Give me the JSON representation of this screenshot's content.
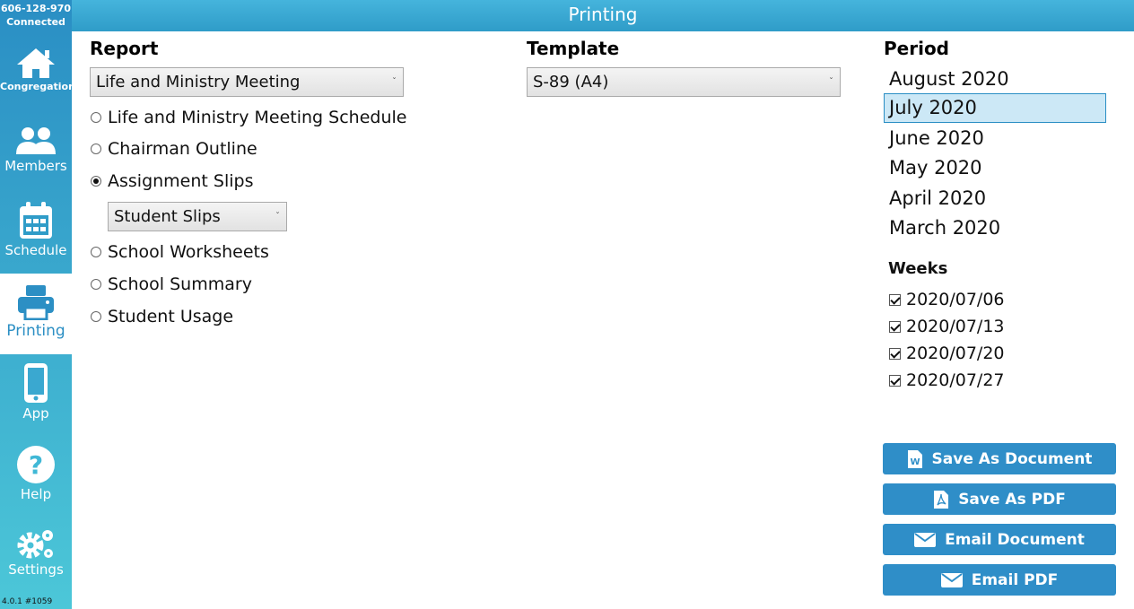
{
  "header": {
    "title": "Printing"
  },
  "sidebar": {
    "connection_id": "606-128-970",
    "connection_status": "Connected",
    "items": [
      {
        "label": "Congregation",
        "icon": "home-icon"
      },
      {
        "label": "Members",
        "icon": "users-icon"
      },
      {
        "label": "Schedule",
        "icon": "calendar-icon"
      },
      {
        "label": "Printing",
        "icon": "printer-icon",
        "active": true
      },
      {
        "label": "App",
        "icon": "phone-icon"
      },
      {
        "label": "Help",
        "icon": "help-icon"
      },
      {
        "label": "Settings",
        "icon": "gears-icon"
      }
    ],
    "version": "4.0.1 #1059"
  },
  "report": {
    "heading": "Report",
    "selected": "Life and Ministry Meeting",
    "options": [
      {
        "label": "Life and Ministry Meeting Schedule",
        "checked": false
      },
      {
        "label": "Chairman Outline",
        "checked": false
      },
      {
        "label": "Assignment Slips",
        "checked": true
      },
      {
        "label": "School Worksheets",
        "checked": false
      },
      {
        "label": "School Summary",
        "checked": false
      },
      {
        "label": "Student Usage",
        "checked": false
      }
    ],
    "slip_type": "Student Slips"
  },
  "template": {
    "heading": "Template",
    "selected": "S-89 (A4)"
  },
  "period": {
    "heading": "Period",
    "items": [
      "August 2020",
      "July 2020",
      "June 2020",
      "May 2020",
      "April 2020",
      "March 2020"
    ],
    "selected": "July 2020"
  },
  "weeks": {
    "heading": "Weeks",
    "items": [
      {
        "label": "2020/07/06",
        "checked": true
      },
      {
        "label": "2020/07/13",
        "checked": true
      },
      {
        "label": "2020/07/20",
        "checked": true
      },
      {
        "label": "2020/07/27",
        "checked": true
      }
    ]
  },
  "actions": {
    "save_document": "Save As Document",
    "save_pdf": "Save As PDF",
    "email_document": "Email Document",
    "email_pdf": "Email PDF"
  },
  "colors": {
    "accent": "#2f8ec8",
    "selected_bg": "#cce8f6"
  }
}
